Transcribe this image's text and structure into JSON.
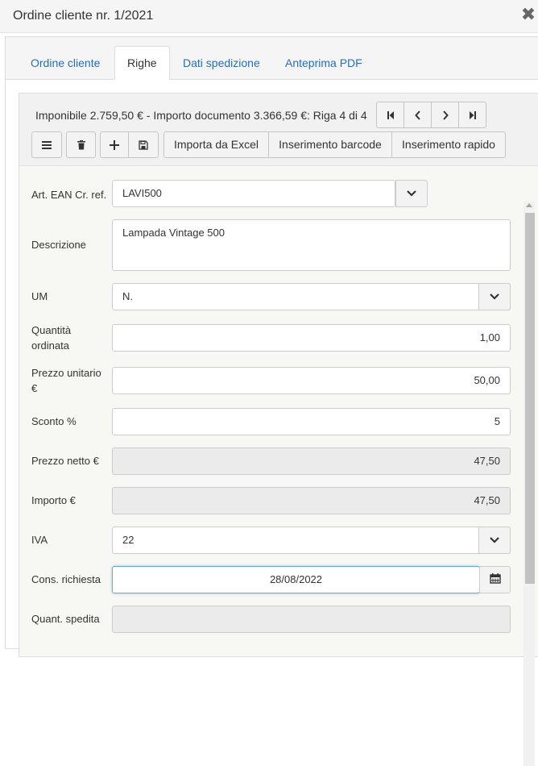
{
  "window": {
    "title": "Ordine cliente nr. 1/2021",
    "close_glyph": "✖"
  },
  "tabs": [
    {
      "label": "Ordine cliente",
      "active": false
    },
    {
      "label": "Righe",
      "active": true
    },
    {
      "label": "Dati spedizione",
      "active": false
    },
    {
      "label": "Anteprima PDF",
      "active": false
    }
  ],
  "toolbar": {
    "summary": "Imponibile 2.759,50 € - Importo documento 3.366,59 €: Riga 4 di 4",
    "icons": [
      "first-page-icon",
      "chevron-left-icon",
      "chevron-right-icon",
      "last-page-icon",
      "menu-icon",
      "trash-icon",
      "plus-icon",
      "floppy-icon"
    ],
    "import_excel": "Importa da Excel",
    "barcode": "Inserimento barcode",
    "quick": "Inserimento rapido"
  },
  "form": {
    "ean_label": "Art. EAN Cr. ref.",
    "ean_value": "LAVI500",
    "desc_label": "Descrizione",
    "desc_value": "Lampada Vintage 500",
    "um_label": "UM",
    "um_value": "N.",
    "qty_label": "Quantità ordinata",
    "qty_value": "1,00",
    "price_label": "Prezzo unitario €",
    "price_value": "50,00",
    "discount_label": "Sconto %",
    "discount_value": "5",
    "net_label": "Prezzo netto €",
    "net_value": "47,50",
    "amount_label": "Importo €",
    "amount_value": "47,50",
    "vat_label": "IVA",
    "vat_value": "22",
    "date_label": "Cons. richiesta",
    "date_value": "28/08/2022",
    "shipped_label": "Quant. spedita",
    "shipped_value": ""
  }
}
